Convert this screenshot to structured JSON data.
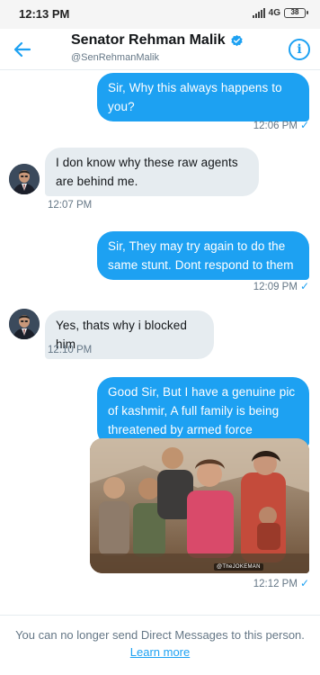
{
  "status_bar": {
    "time": "12:13 PM",
    "network": "4G",
    "battery": "38"
  },
  "header": {
    "name": "Senator Rehman Malik",
    "handle": "@SenRehmanMalik"
  },
  "messages": [
    {
      "direction": "out",
      "text": "Sir, Why this always happens to you?",
      "time": "12:06 PM"
    },
    {
      "direction": "in",
      "text": "I don know why these raw agents are behind me.",
      "time": "12:07 PM"
    },
    {
      "direction": "out",
      "text": "Sir, They may try again to do the same stunt. Dont respond to them",
      "time": "12:09 PM"
    },
    {
      "direction": "in",
      "text": "Yes, thats why i blocked him",
      "time": "12:10 PM"
    },
    {
      "direction": "out",
      "text": "Good Sir, But I have a genuine pic of kashmir, A full family is being threatened by armed force",
      "time": "12:12 PM",
      "photo_watermark": "@TheJOKEMAN"
    }
  ],
  "footer": {
    "notice": "You can no longer send Direct Messages to this person.",
    "link": "Learn more"
  },
  "colors": {
    "accent": "#1da1f2",
    "incoming_bubble": "#e6ecf0",
    "muted_text": "#657786"
  }
}
